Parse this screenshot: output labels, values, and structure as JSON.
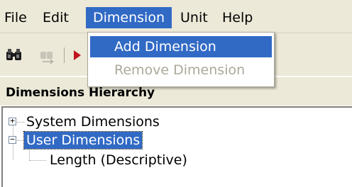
{
  "menubar": {
    "file": "File",
    "edit": "Edit",
    "dimension": "Dimension",
    "unit": "Unit",
    "help": "Help"
  },
  "toolbar": {
    "icons": [
      "binoculars-icon",
      "move-icon",
      "play-icon"
    ]
  },
  "hierarchy": {
    "title": "Dimensions Hierarchy",
    "items": [
      {
        "label": "System Dimensions",
        "expander": "+"
      },
      {
        "label": "User Dimensions",
        "expander": "−"
      },
      {
        "label": "Length (Descriptive)"
      }
    ]
  },
  "dimension_menu": {
    "items": [
      "Add Dimension",
      "Remove Dimension"
    ]
  },
  "colors": {
    "selection": "#316ac5",
    "chrome": "#ece9d8",
    "disabled_text": "#aca899"
  }
}
